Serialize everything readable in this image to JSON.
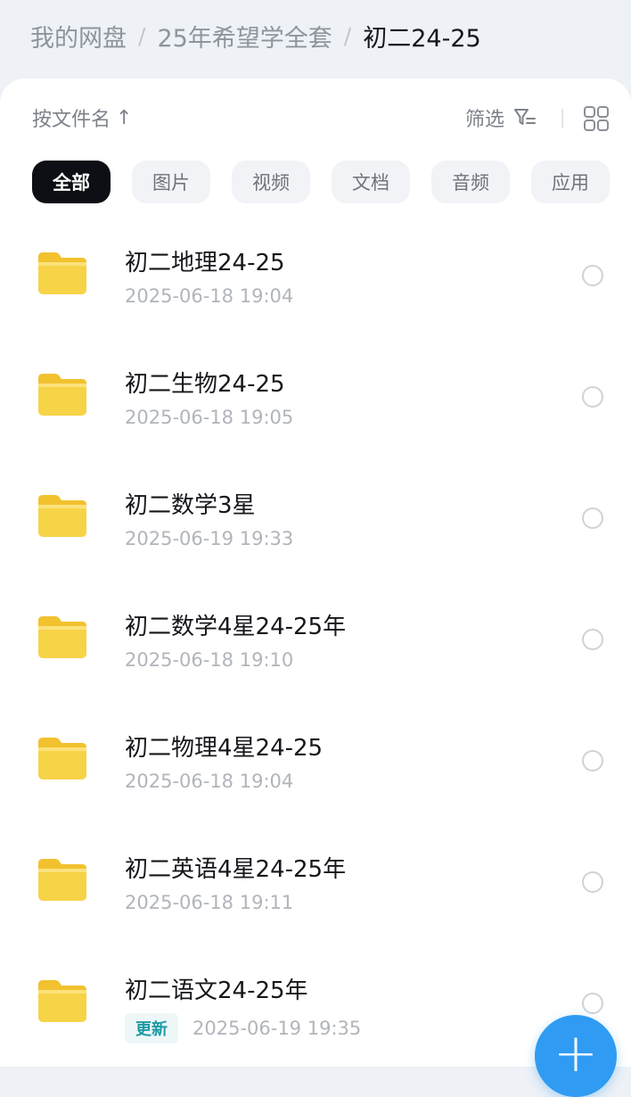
{
  "breadcrumb": {
    "items": [
      "我的网盘",
      "25年希望学全套",
      "初二24-25"
    ],
    "separator": "/"
  },
  "toolbar": {
    "sort_label": "按文件名",
    "sort_arrow": "↑",
    "filter_label": "筛选",
    "filter_icon": "filter-icon",
    "view_icon": "grid-view-icon"
  },
  "tabs": [
    {
      "label": "全部",
      "active": true
    },
    {
      "label": "图片",
      "active": false
    },
    {
      "label": "视频",
      "active": false
    },
    {
      "label": "文档",
      "active": false
    },
    {
      "label": "音频",
      "active": false
    },
    {
      "label": "应用",
      "active": false
    }
  ],
  "files": [
    {
      "name": "初二地理24-25",
      "date": "2025-06-18  19:04",
      "badge": ""
    },
    {
      "name": "初二生物24-25",
      "date": "2025-06-18  19:05",
      "badge": ""
    },
    {
      "name": "初二数学3星",
      "date": "2025-06-19  19:33",
      "badge": ""
    },
    {
      "name": "初二数学4星24-25年",
      "date": "2025-06-18  19:10",
      "badge": ""
    },
    {
      "name": "初二物理4星24-25",
      "date": "2025-06-18  19:04",
      "badge": ""
    },
    {
      "name": "初二英语4星24-25年",
      "date": "2025-06-18  19:11",
      "badge": ""
    },
    {
      "name": "初二语文24-25年",
      "date": "2025-06-19  19:35",
      "badge": "更新"
    }
  ],
  "fab": {
    "label": "+",
    "icon": "plus-icon"
  },
  "colors": {
    "background": "#eef1f6",
    "panel": "#ffffff",
    "active_tab": "#0d0f14",
    "folder": "#f7cf3a",
    "badge_text": "#1f9aa6",
    "fab": "#2f9bf2"
  }
}
